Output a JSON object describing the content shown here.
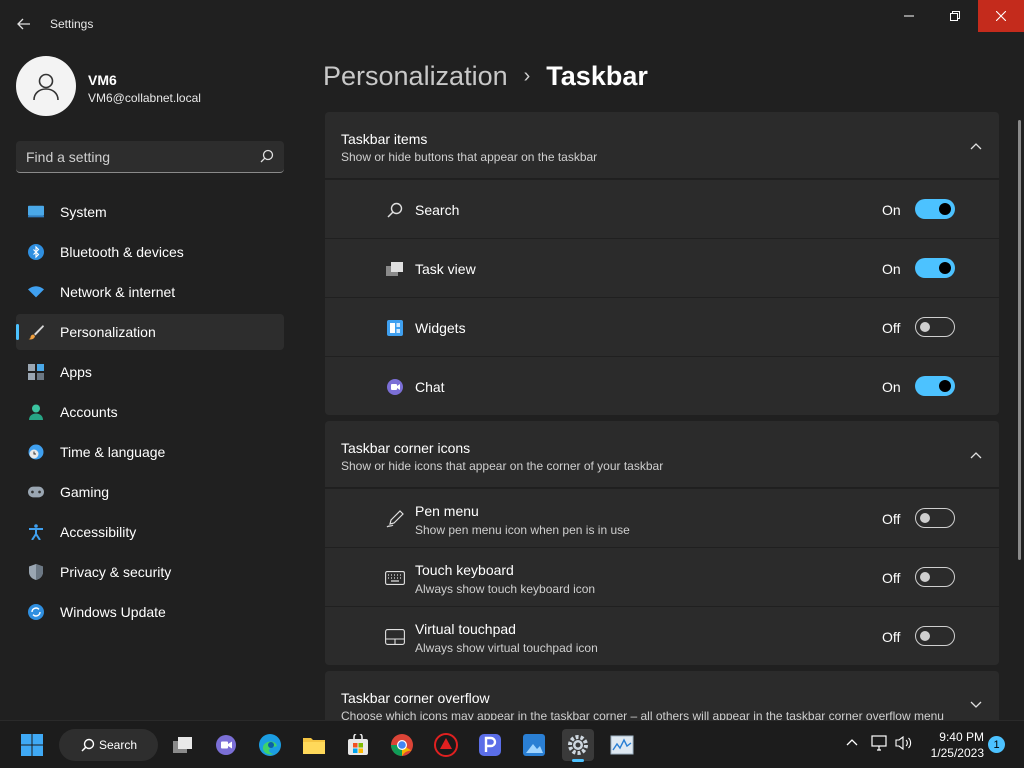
{
  "window": {
    "title": "Settings"
  },
  "profile": {
    "name": "VM6",
    "email": "VM6@collabnet.local"
  },
  "search": {
    "placeholder": "Find a setting"
  },
  "sidebar": {
    "items": [
      {
        "label": "System",
        "icon": "system-icon",
        "active": false
      },
      {
        "label": "Bluetooth & devices",
        "icon": "bluetooth-icon",
        "active": false
      },
      {
        "label": "Network & internet",
        "icon": "wifi-icon",
        "active": false
      },
      {
        "label": "Personalization",
        "icon": "brush-icon",
        "active": true
      },
      {
        "label": "Apps",
        "icon": "apps-icon",
        "active": false
      },
      {
        "label": "Accounts",
        "icon": "person-icon",
        "active": false
      },
      {
        "label": "Time & language",
        "icon": "clock-globe-icon",
        "active": false
      },
      {
        "label": "Gaming",
        "icon": "gamepad-icon",
        "active": false
      },
      {
        "label": "Accessibility",
        "icon": "accessibility-icon",
        "active": false
      },
      {
        "label": "Privacy & security",
        "icon": "shield-icon",
        "active": false
      },
      {
        "label": "Windows Update",
        "icon": "update-icon",
        "active": false
      }
    ]
  },
  "breadcrumb": {
    "parent": "Personalization",
    "separator": "›",
    "current": "Taskbar"
  },
  "groups": {
    "taskbar_items": {
      "title": "Taskbar items",
      "desc": "Show or hide buttons that appear on the taskbar",
      "rows": [
        {
          "label": "Search",
          "state": "On",
          "on": true,
          "icon": "search-icon"
        },
        {
          "label": "Task view",
          "state": "On",
          "on": true,
          "icon": "task-view-icon"
        },
        {
          "label": "Widgets",
          "state": "Off",
          "on": false,
          "icon": "widgets-icon"
        },
        {
          "label": "Chat",
          "state": "On",
          "on": true,
          "icon": "chat-icon"
        }
      ]
    },
    "corner_icons": {
      "title": "Taskbar corner icons",
      "desc": "Show or hide icons that appear on the corner of your taskbar",
      "rows": [
        {
          "label": "Pen menu",
          "sub": "Show pen menu icon when pen is in use",
          "state": "Off",
          "on": false,
          "icon": "pen-icon"
        },
        {
          "label": "Touch keyboard",
          "sub": "Always show touch keyboard icon",
          "state": "Off",
          "on": false,
          "icon": "keyboard-icon"
        },
        {
          "label": "Virtual touchpad",
          "sub": "Always show virtual touchpad icon",
          "state": "Off",
          "on": false,
          "icon": "touchpad-icon"
        }
      ]
    },
    "corner_overflow": {
      "title": "Taskbar corner overflow",
      "desc": "Choose which icons may appear in the taskbar corner – all others will appear in the taskbar corner overflow menu"
    }
  },
  "taskbar": {
    "search_label": "Search",
    "time": "9:40 PM",
    "date": "1/25/2023",
    "notification_count": "1",
    "apps": [
      "start-icon",
      "task-view-icon",
      "teams-chat-icon",
      "edge-icon",
      "file-explorer-icon",
      "store-icon",
      "chrome-icon",
      "app-red-icon",
      "app-p-icon",
      "app-blue-icon",
      "settings-icon",
      "resource-monitor-icon"
    ]
  },
  "colors": {
    "accent": "#4cc2ff",
    "background": "#202020",
    "card": "#2b2b2b",
    "close_button": "#c42b1c"
  }
}
